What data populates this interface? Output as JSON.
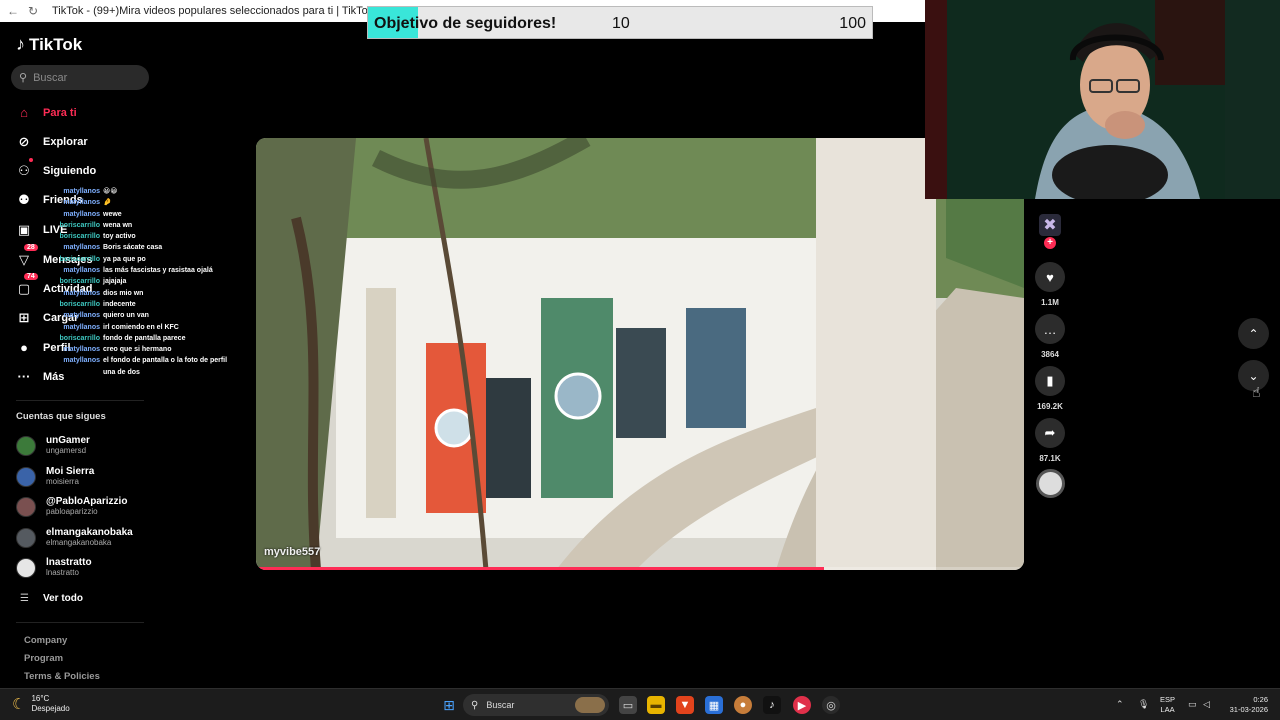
{
  "browser": {
    "tab_title": "TikTok - (99+)Mira videos populares seleccionados para ti | TikTok"
  },
  "follower_goal": {
    "label": "Objetivo de seguidores!",
    "current": "10",
    "target": "100",
    "progress_fraction": 0.1
  },
  "sidebar": {
    "logo": "TikTok",
    "search_placeholder": "Buscar",
    "nav": [
      {
        "label": "Para ti",
        "icon": "home-icon"
      },
      {
        "label": "Explorar",
        "icon": "compass-icon"
      },
      {
        "label": "Siguiendo",
        "icon": "following-icon"
      },
      {
        "label": "Friends",
        "icon": "friends-icon"
      },
      {
        "label": "LIVE",
        "icon": "live-icon"
      },
      {
        "label": "Mensajes",
        "icon": "messages-icon",
        "badge": "28"
      },
      {
        "label": "Actividad",
        "icon": "activity-icon",
        "badge": "74"
      },
      {
        "label": "Cargar",
        "icon": "upload-icon"
      },
      {
        "label": "Perfil",
        "icon": "profile-icon"
      },
      {
        "label": "Más",
        "icon": "more-icon"
      }
    ],
    "following_title": "Cuentas que sigues",
    "accounts": [
      {
        "name": "unGamer",
        "handle": "ungamersd"
      },
      {
        "name": "Moi Sierra",
        "handle": "moisierra"
      },
      {
        "name": "@PabloAparizzio",
        "handle": "pabloaparizzio"
      },
      {
        "name": "elmangakanobaka",
        "handle": "elmangakanobaka"
      },
      {
        "name": "lnastratto",
        "handle": "lnastratto"
      }
    ],
    "see_all": "Ver todo",
    "footer": [
      "Company",
      "Program",
      "Terms & Policies"
    ]
  },
  "chat": [
    {
      "user": "matyllanos",
      "color": "#7fb0ff",
      "msg": "😀😀"
    },
    {
      "user": "matyllanos",
      "color": "#7fb0ff",
      "msg": "🤌"
    },
    {
      "user": "matyllanos",
      "color": "#7fb0ff",
      "msg": "wewe"
    },
    {
      "user": "boriscarrillo",
      "color": "#3ec7c0",
      "msg": "wena wn"
    },
    {
      "user": "boriscarrillo",
      "color": "#3ec7c0",
      "msg": "toy activo"
    },
    {
      "user": "matyllanos",
      "color": "#7fb0ff",
      "msg": "Boris sácate casa"
    },
    {
      "user": "boriscarrillo",
      "color": "#3ec7c0",
      "msg": "ya pa que po"
    },
    {
      "user": "matyllanos",
      "color": "#7fb0ff",
      "msg": "las más fascistas y rasistaa ojalá"
    },
    {
      "user": "boriscarrillo",
      "color": "#3ec7c0",
      "msg": "jajajaja"
    },
    {
      "user": "matyllanos",
      "color": "#7fb0ff",
      "msg": "dios mio wn"
    },
    {
      "user": "boriscarrillo",
      "color": "#3ec7c0",
      "msg": "indecente"
    },
    {
      "user": "matyllanos",
      "color": "#7fb0ff",
      "msg": "quiero un van"
    },
    {
      "user": "matyllanos",
      "color": "#7fb0ff",
      "msg": "irl comiendo en el KFC"
    },
    {
      "user": "boriscarrillo",
      "color": "#3ec7c0",
      "msg": "fondo de pantalla parece"
    },
    {
      "user": "matyllanos",
      "color": "#7fb0ff",
      "msg": "creo que si hermano"
    },
    {
      "user": "matyllanos",
      "color": "#7fb0ff",
      "msg": "el fondo de pantalla o la foto de perfil"
    },
    {
      "user": "",
      "color": "#7fb0ff",
      "msg": "una de dos"
    }
  ],
  "video": {
    "author": "myvibe557",
    "progress_fraction": 0.74
  },
  "actions": {
    "likes": "1.1M",
    "comments": "3864",
    "saves": "169.2K",
    "shares": "87.1K"
  },
  "taskbar": {
    "temperature": "16°C",
    "weather": "Despejado",
    "search_placeholder": "Buscar",
    "lang1": "ESP",
    "lang2": "LAA",
    "time": "0:26",
    "date": "31-03-2026"
  },
  "colors": {
    "accent": "#fe2c55",
    "goal_fill": "#39e6d9"
  }
}
